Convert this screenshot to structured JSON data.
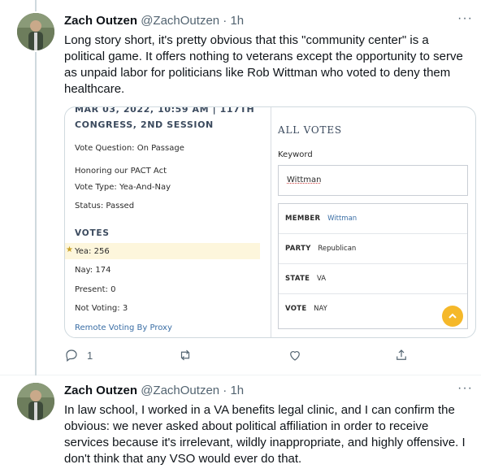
{
  "tweets": [
    {
      "name": "Zach Outzen",
      "handle": "@ZachOutzen",
      "separator": "·",
      "time": "1h",
      "more": "···",
      "text": "Long story short, it's pretty obvious that this \"community center\" is a political game. It offers nothing to veterans except the opportunity to serve as unpaid labor for politicians like Rob Wittman who voted to deny them healthcare.",
      "actions": {
        "reply_count": "1",
        "retweet_count": "",
        "like_count": ""
      }
    },
    {
      "name": "Zach Outzen",
      "handle": "@ZachOutzen",
      "separator": "·",
      "time": "1h",
      "more": "···",
      "text": "In law school, I worked in a VA benefits legal clinic, and I can confirm the obvious: we never asked about political affiliation in order to receive services because it's irrelevant, wildly inappropriate, and highly offensive. I don't think that any VSO would ever do that."
    }
  ],
  "vote_card": {
    "date_line": "MAR 03, 2022, 10:59 AM | 117TH",
    "session_line": "CONGRESS, 2ND SESSION",
    "question": "Vote Question: On Passage",
    "bill": "Honoring our PACT Act",
    "vote_type": "Vote Type: Yea-And-Nay",
    "status": "Status: Passed",
    "votes_title": "VOTES",
    "yea": "Yea: 256",
    "nay": "Nay: 174",
    "present": "Present: 0",
    "not_voting": "Not Voting: 3",
    "proxy_link": "Remote Voting By Proxy",
    "star": "★"
  },
  "all_votes": {
    "title": "ALL VOTES",
    "keyword_label": "Keyword",
    "keyword_value": "Wittman",
    "rows": [
      {
        "label": "MEMBER",
        "value": "Wittman"
      },
      {
        "label": "PARTY",
        "value": "Republican"
      },
      {
        "label": "STATE",
        "value": "VA"
      },
      {
        "label": "VOTE",
        "value": "NAY"
      }
    ]
  },
  "colors": {
    "accent_yellow": "#f5b82a",
    "link_blue": "#3a6ea5",
    "muted": "#536471"
  },
  "icons": [
    "reply-icon",
    "retweet-icon",
    "like-icon",
    "share-icon",
    "more-icon",
    "chevron-up-icon",
    "star-icon"
  ]
}
